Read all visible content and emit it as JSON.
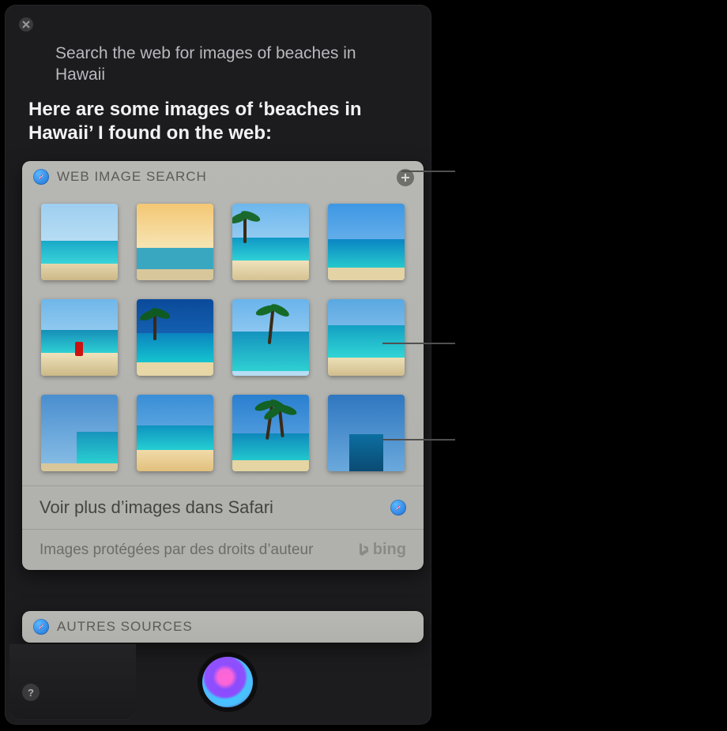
{
  "query": "Search the web for images of beaches in Hawaii",
  "reply": "Here are some images of ‘beaches in Hawaii’ I found on the web:",
  "webCard": {
    "title": "WEB IMAGE SEARCH",
    "more": "Voir plus d’images dans Safari",
    "copyright": "Images protégées par des droits d’auteur",
    "provider": "bing"
  },
  "otherCard": {
    "title": "AUTRES SOURCES"
  },
  "help": "?"
}
